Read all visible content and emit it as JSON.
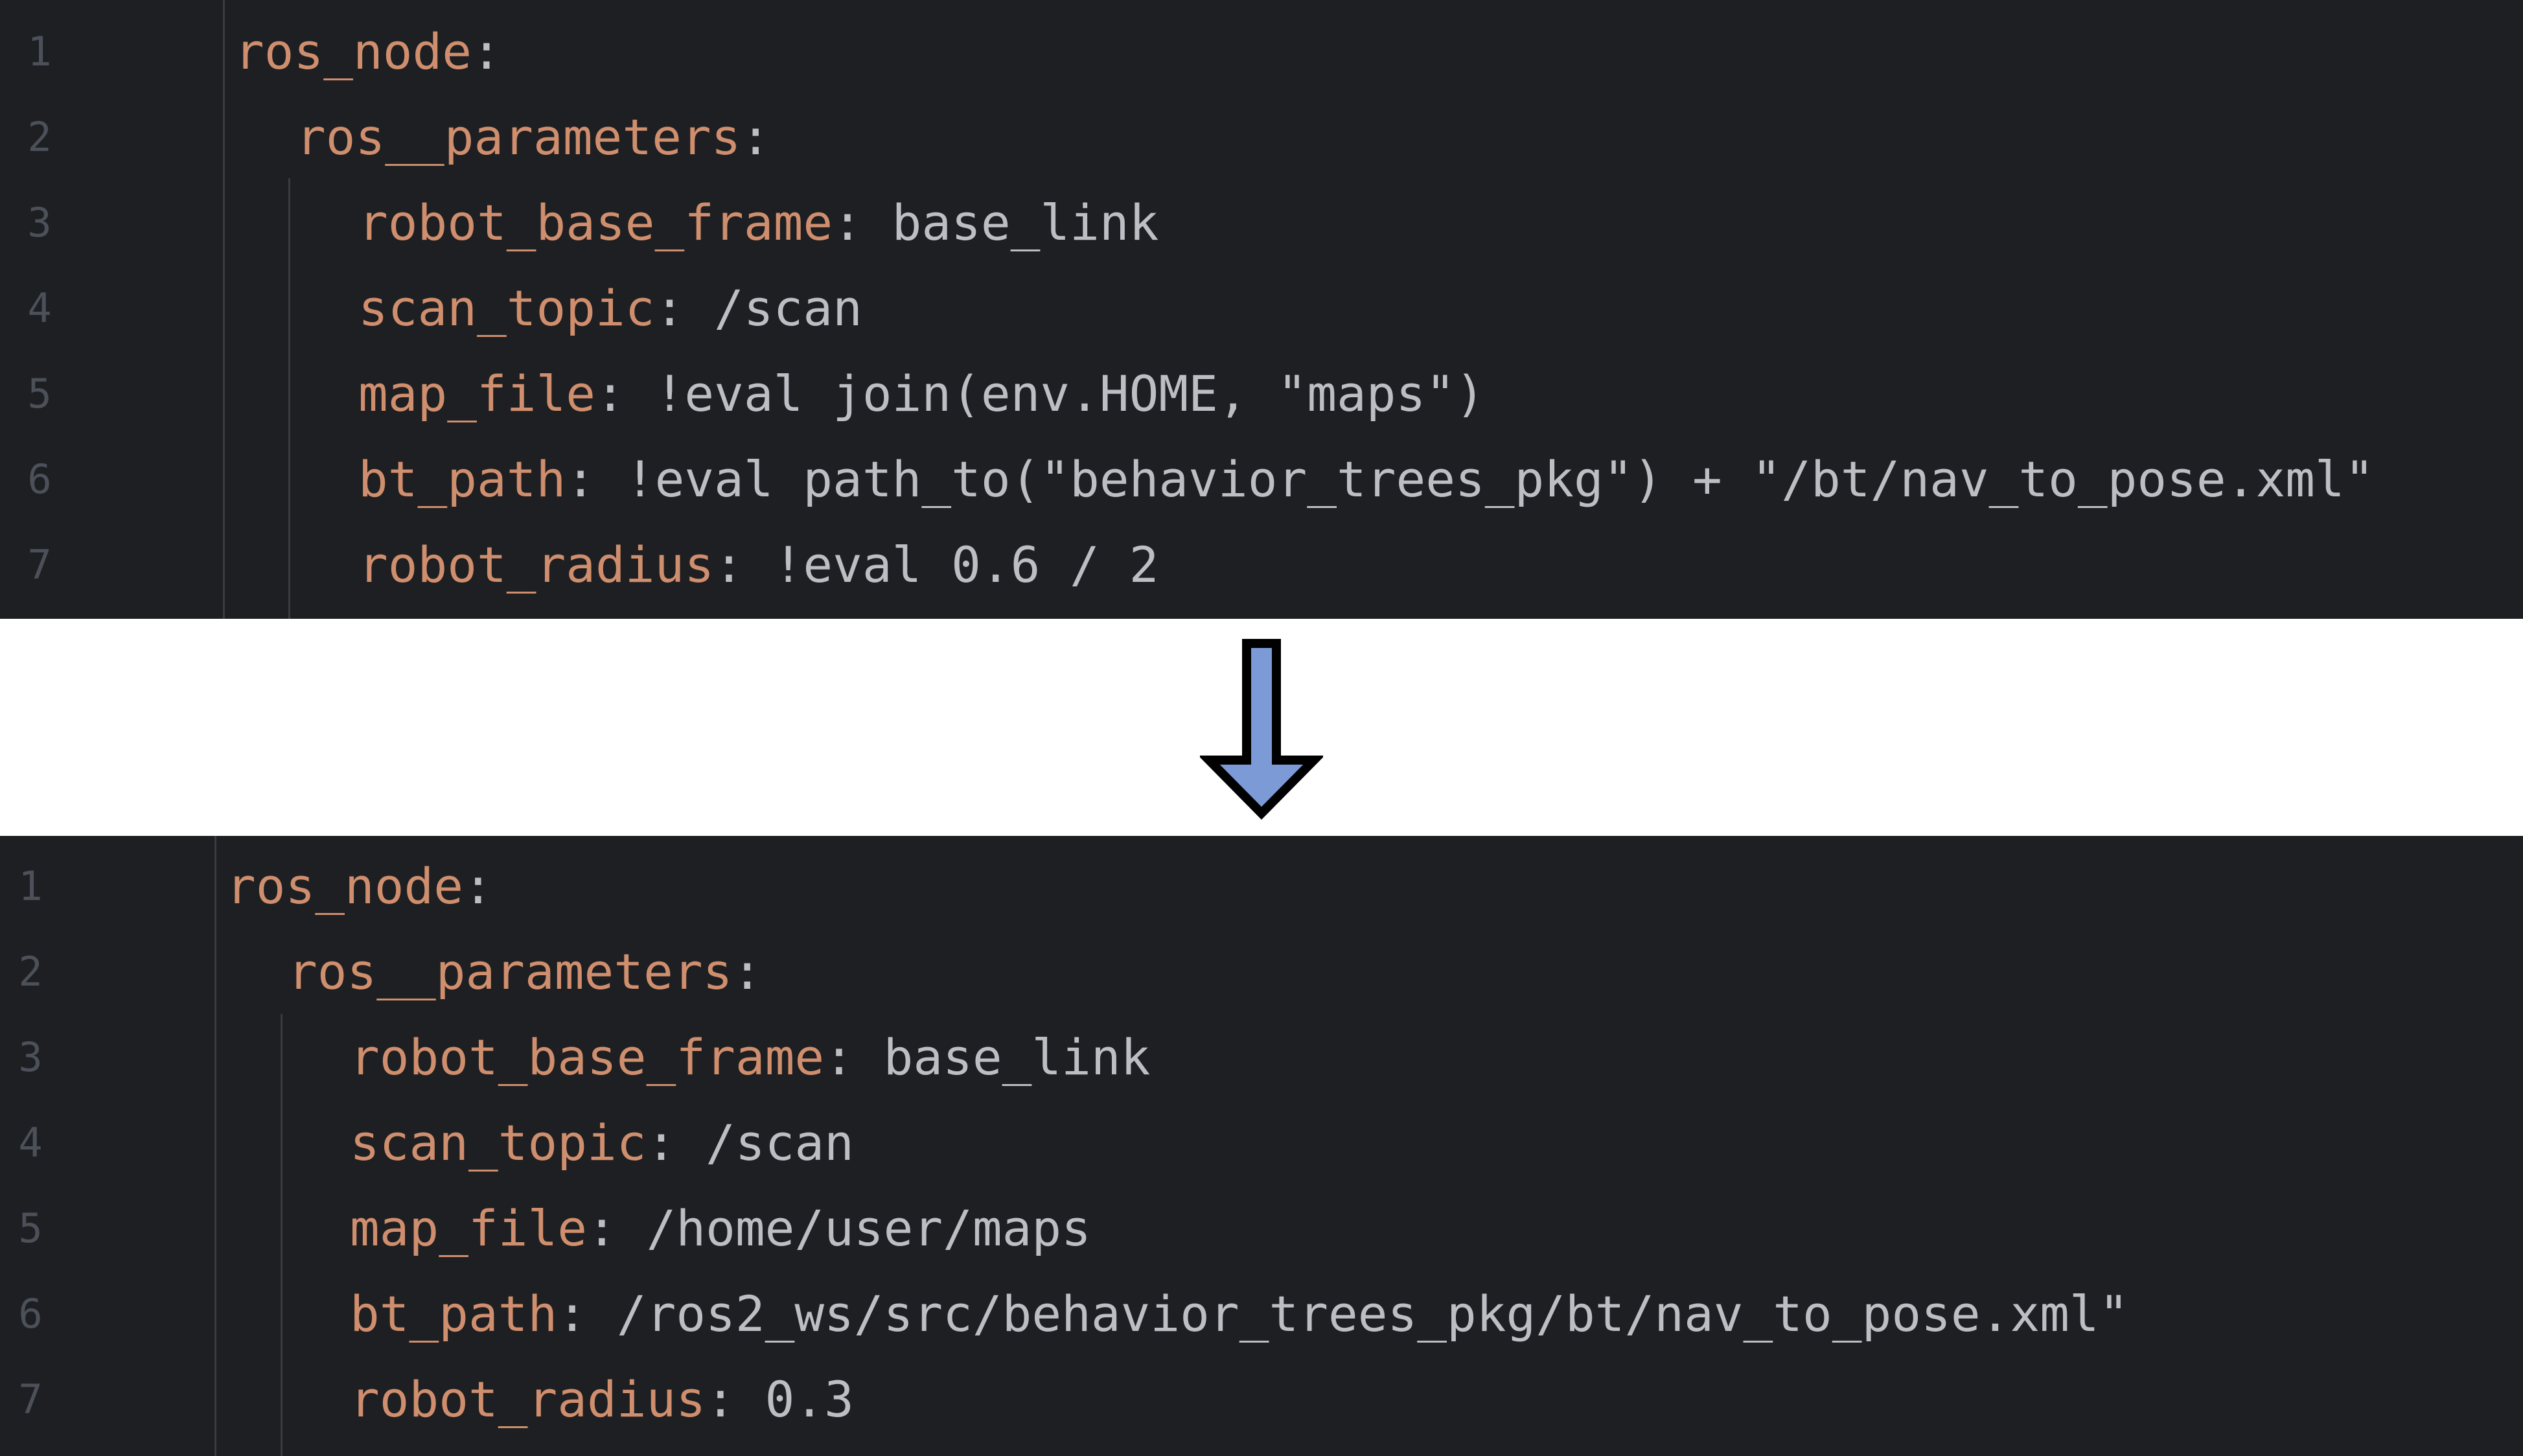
{
  "colors": {
    "editor_background": "#1e1f22",
    "line_number": "#4b5059",
    "key": "#cf8e6d",
    "text": "#bcbec4",
    "indent_guide": "#393b40",
    "arrow_fill": "#7b9ad6",
    "arrow_stroke": "#000000"
  },
  "before": {
    "lines": [
      {
        "number": "1",
        "key": "ros_node",
        "sep": ":",
        "value": ""
      },
      {
        "number": "2",
        "key": "ros__parameters",
        "sep": ":",
        "value": ""
      },
      {
        "number": "3",
        "key": "robot_base_frame",
        "sep": ":",
        "value": " base_link"
      },
      {
        "number": "4",
        "key": "scan_topic",
        "sep": ":",
        "value": " /scan"
      },
      {
        "number": "5",
        "key": "map_file",
        "sep": ":",
        "value": " !eval join(env.HOME, \"maps\")"
      },
      {
        "number": "6",
        "key": "bt_path",
        "sep": ":",
        "value": " !eval path_to(\"behavior_trees_pkg\") + \"/bt/nav_to_pose.xml\""
      },
      {
        "number": "7",
        "key": "robot_radius",
        "sep": ":",
        "value": " !eval 0.6 / 2"
      }
    ]
  },
  "transform_arrow_icon": "down-arrow-icon",
  "after": {
    "lines": [
      {
        "number": "1",
        "key": "ros_node",
        "sep": ":",
        "value": ""
      },
      {
        "number": "2",
        "key": "ros__parameters",
        "sep": ":",
        "value": ""
      },
      {
        "number": "3",
        "key": "robot_base_frame",
        "sep": ":",
        "value": " base_link"
      },
      {
        "number": "4",
        "key": "scan_topic",
        "sep": ":",
        "value": " /scan"
      },
      {
        "number": "5",
        "key": "map_file",
        "sep": ":",
        "value": " /home/user/maps"
      },
      {
        "number": "6",
        "key": "bt_path",
        "sep": ":",
        "value": " /ros2_ws/src/behavior_trees_pkg/bt/nav_to_pose.xml\""
      },
      {
        "number": "7",
        "key": "robot_radius",
        "sep": ":",
        "value": " 0.3"
      }
    ]
  }
}
